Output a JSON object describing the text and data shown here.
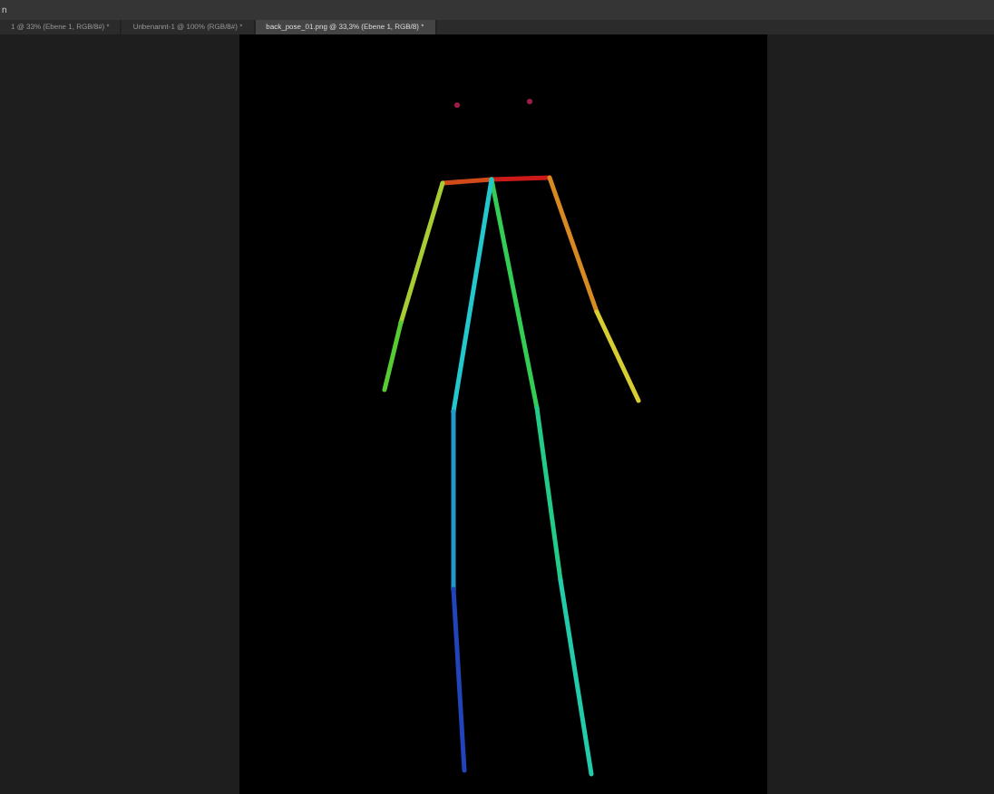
{
  "menu_bar": {
    "label": "n"
  },
  "tabs": [
    {
      "label": "1 @ 33% (Ebene 1, RGB/8#) *",
      "selected": false
    },
    {
      "label": "Unbenannt-1 @ 100% (RGB/8#) *",
      "selected": false
    },
    {
      "label": "back_pose_01.png @ 33,3% (Ebene 1, RGB/8) *",
      "selected": true
    }
  ]
}
